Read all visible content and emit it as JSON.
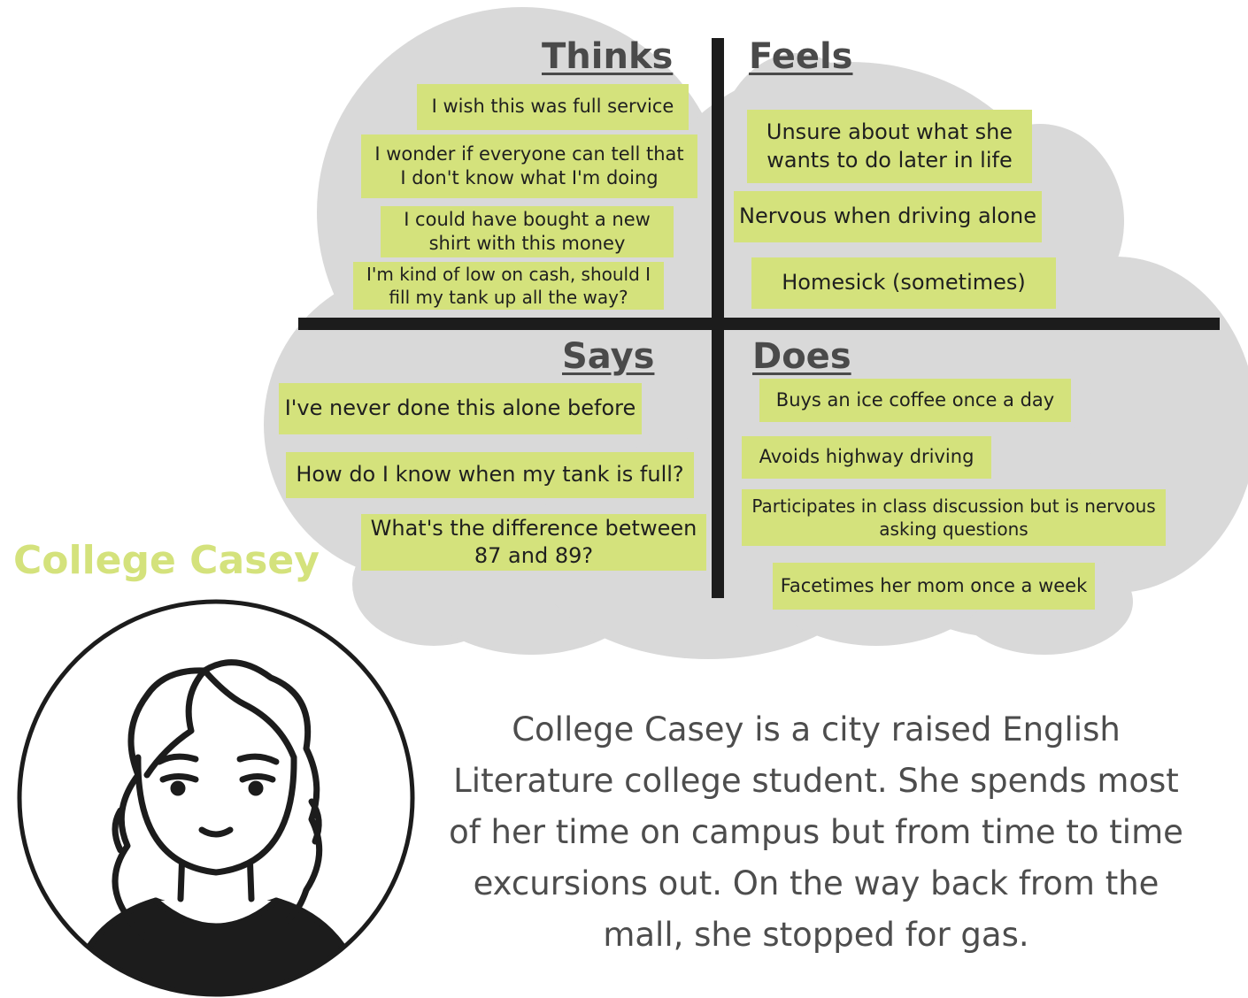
{
  "quadrants": {
    "thinks": {
      "title": "Thinks",
      "notes": [
        "I wish this was full service",
        "I wonder if everyone can tell that\nI don't know what I'm doing",
        "I could have bought a new\nshirt with this money",
        "I'm kind of low on cash, should I\nfill my tank up all the way?"
      ]
    },
    "feels": {
      "title": "Feels",
      "notes": [
        "Unsure about what she\nwants to do later in life",
        "Nervous when driving alone",
        "Homesick (sometimes)"
      ]
    },
    "says": {
      "title": "Says",
      "notes": [
        "I've never done this alone before",
        "How do I know when my tank is full?",
        "What's the difference between\n87 and 89?"
      ]
    },
    "does": {
      "title": "Does",
      "notes": [
        "Buys an ice coffee once a day",
        "Avoids highway driving",
        "Participates in class discussion but is nervous\nasking questions",
        "Facetimes her mom once a week"
      ]
    }
  },
  "persona": {
    "name": "College Casey",
    "bio": "College Casey is a city raised English Literature college student. She spends most of her time on campus but from time to time excursions out. On the way back from the mall, she stopped for gas."
  },
  "colors": {
    "note": "#d4e27c",
    "cloud": "#d9d9d9",
    "divider": "#1c1c1c",
    "heading": "#4a4a4a",
    "name": "#d4e27c"
  }
}
